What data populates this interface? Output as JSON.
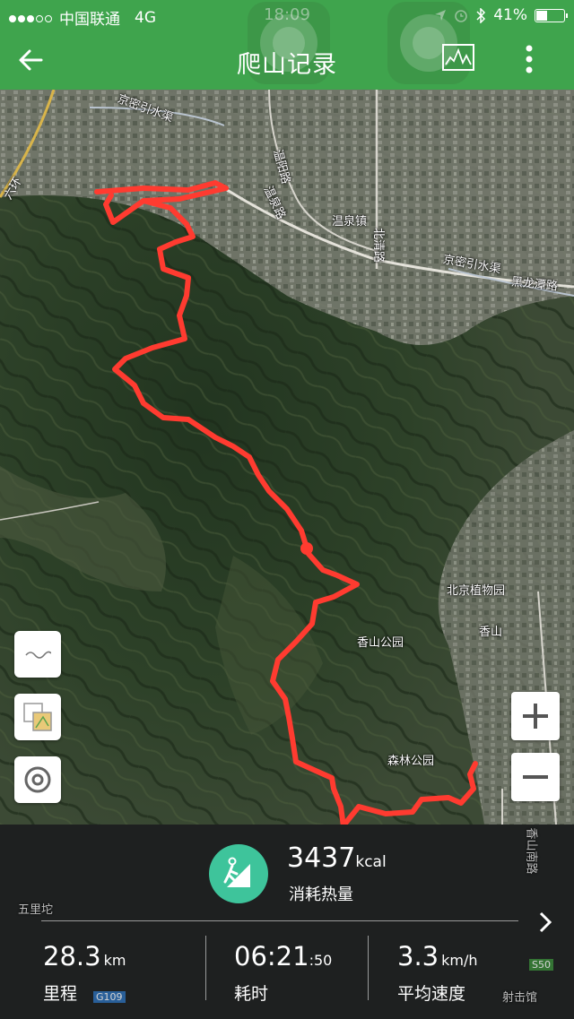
{
  "status": {
    "carrier": "中国联通",
    "network": "4G",
    "time": "18:09",
    "battery": "41%",
    "battery_level": 0.41
  },
  "nav": {
    "title": "爬山记录"
  },
  "map_labels": {
    "canal_nw": "京密引水渠",
    "canal_ne": "京密引水渠",
    "wenquan": "温泉镇",
    "road_1": "温阳路",
    "road_2": "温泉路",
    "road_3": "黑龙潭路",
    "road_4": "北清路",
    "ring": "六环",
    "botanical": "北京植物园",
    "xiangshan": "香山",
    "xiangshan_park": "香山公园",
    "forest_park": "森林公园",
    "wulituo": "五里坨",
    "xiangshan_road": "香山南路",
    "shejiguan": "射击馆",
    "g109": "G109",
    "s50": "S50"
  },
  "summary": {
    "kcal_value": "3437",
    "kcal_unit": "kcal",
    "kcal_label": "消耗热量"
  },
  "stats": [
    {
      "value": "28.3",
      "unit": "km",
      "label": "里程"
    },
    {
      "value": "06:21",
      "unit": ":50",
      "label": "耗时"
    },
    {
      "value": "3.3",
      "unit": "km/h",
      "label": "平均速度"
    }
  ],
  "colors": {
    "brand_green": "#3fa44d",
    "route_red": "#ff3b30",
    "badge_teal": "#3ec49b"
  }
}
